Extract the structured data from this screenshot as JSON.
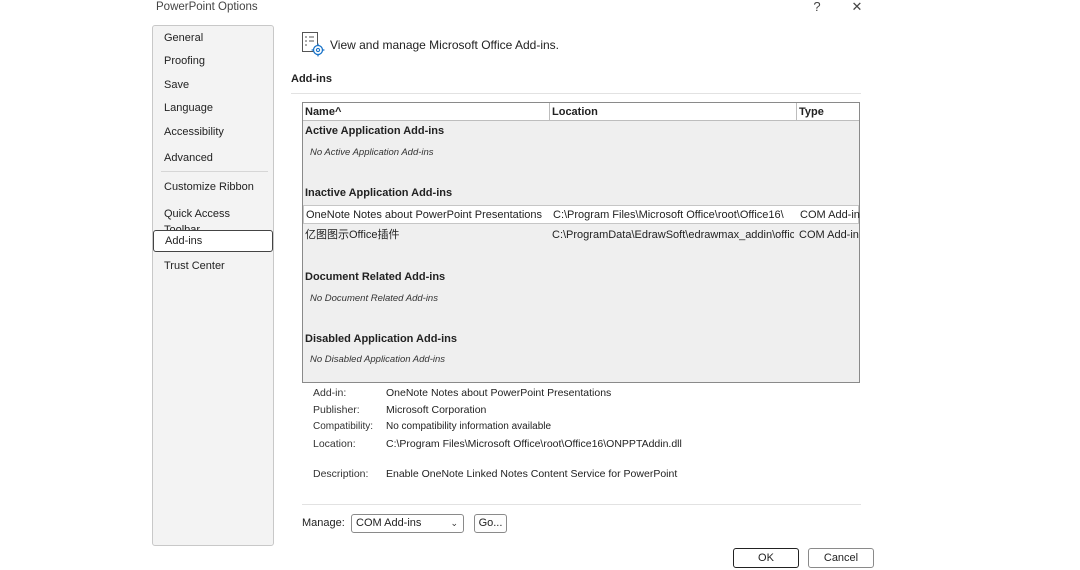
{
  "window": {
    "title": "PowerPoint Options",
    "help_icon": "?",
    "close_icon": "✕"
  },
  "sidebar": {
    "items": [
      {
        "label": "General"
      },
      {
        "label": "Proofing"
      },
      {
        "label": "Save"
      },
      {
        "label": "Language"
      },
      {
        "label": "Accessibility"
      },
      {
        "label": "Advanced"
      },
      {
        "label": "Customize Ribbon"
      },
      {
        "label": "Quick Access Toolbar"
      },
      {
        "label": "Add-ins",
        "selected": true
      },
      {
        "label": "Trust Center"
      }
    ]
  },
  "header": {
    "icon": "addins-settings-icon",
    "text": "View and manage Microsoft Office Add-ins."
  },
  "section_title": "Add-ins",
  "table": {
    "columns": [
      "Name",
      "Location",
      "Type"
    ],
    "sort_indicator": "^",
    "groups": {
      "active": {
        "title": "Active Application Add-ins",
        "empty": "No Active Application Add-ins"
      },
      "inactive": {
        "title": "Inactive Application Add-ins",
        "rows": [
          {
            "name": "OneNote Notes about PowerPoint Presentations",
            "location": "C:\\Program Files\\Microsoft Office\\root\\Office16\\",
            "type": "COM Add-in",
            "selected": true
          },
          {
            "name": "亿图图示Office插件",
            "location": "C:\\ProgramData\\EdrawSoft\\edrawmax_addin\\offic",
            "type": "COM Add-in",
            "selected": false
          }
        ]
      },
      "document": {
        "title": "Document Related Add-ins",
        "empty": "No Document Related Add-ins"
      },
      "disabled": {
        "title": "Disabled Application Add-ins",
        "empty": "No Disabled Application Add-ins"
      }
    }
  },
  "details": {
    "addin_label": "Add-in:",
    "addin_value": "OneNote Notes about PowerPoint Presentations",
    "publisher_label": "Publisher:",
    "publisher_value": "Microsoft Corporation",
    "compat_label": "Compatibility:",
    "compat_value": "No compatibility information available",
    "location_label": "Location:",
    "location_value": "C:\\Program Files\\Microsoft Office\\root\\Office16\\ONPPTAddin.dll",
    "description_label": "Description:",
    "description_value": "Enable OneNote Linked Notes Content Service for PowerPoint"
  },
  "manage": {
    "label": "Manage:",
    "selected_option": "COM Add-ins",
    "go_label": "Go..."
  },
  "footer": {
    "ok_label": "OK",
    "cancel_label": "Cancel"
  }
}
